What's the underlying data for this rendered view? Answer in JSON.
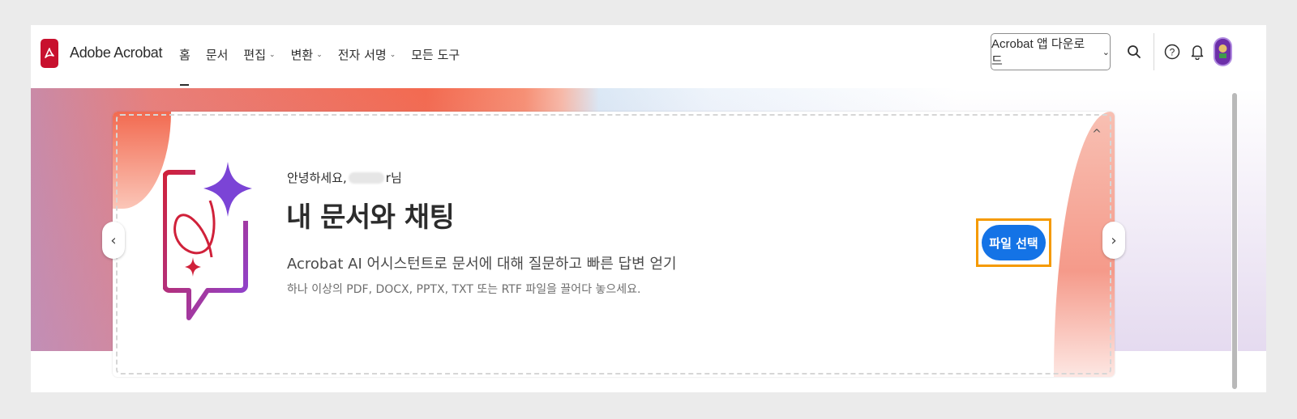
{
  "app": {
    "title": "Adobe Acrobat",
    "logo_icon": "acrobat-logo-icon",
    "brand_color": "#c8102e"
  },
  "nav": {
    "items": [
      {
        "label": "홈",
        "dropdown": false,
        "active": true
      },
      {
        "label": "문서",
        "dropdown": false
      },
      {
        "label": "편집",
        "dropdown": true
      },
      {
        "label": "변환",
        "dropdown": true
      },
      {
        "label": "전자 서명",
        "dropdown": true
      },
      {
        "label": "모든 도구",
        "dropdown": false
      }
    ]
  },
  "header": {
    "download_label": "Acrobat 앱 다운로드",
    "icons": [
      "search-icon",
      "help-icon",
      "bell-icon",
      "avatar"
    ]
  },
  "hero": {
    "greeting_prefix": "안녕하세요,",
    "greeting_suffix": "r님",
    "title": "내 문서와 채팅",
    "subtitle": "Acrobat AI 어시스턴트로 문서에 대해 질문하고 빠른 답변 얻기",
    "hint": "하나 이상의 PDF, DOCX, PPTX, TXT 또는 RTF 파일을 끌어다 놓으세요.",
    "button_label": "파일 선택",
    "accent_color": "#1473e6",
    "highlight_color": "#f59a00"
  },
  "carousel": {
    "prev_glyph": "‹",
    "next_glyph": "›",
    "collapse_glyph": "^"
  }
}
